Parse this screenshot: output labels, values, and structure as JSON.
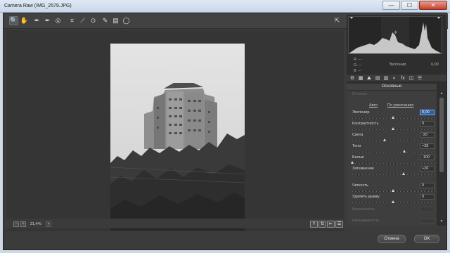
{
  "window": {
    "title": "Camera Raw (IMG_2579.JPG)",
    "minimize": "—",
    "maximize": "☐",
    "close": "✕"
  },
  "toolbar": {
    "tools": [
      {
        "icon": "zoom-icon",
        "glyph": "🔍"
      },
      {
        "icon": "hand-icon",
        "glyph": "✋"
      },
      {
        "icon": "white-balance-icon",
        "glyph": "✒"
      },
      {
        "icon": "color-sampler-icon",
        "glyph": "✒"
      },
      {
        "icon": "targeted-adjust-icon",
        "glyph": "◎"
      },
      {
        "icon": "crop-icon",
        "glyph": "⌗"
      },
      {
        "icon": "straighten-icon",
        "glyph": "⟋"
      },
      {
        "icon": "red-eye-icon",
        "glyph": "⊙"
      },
      {
        "icon": "brush-icon",
        "glyph": "✎"
      },
      {
        "icon": "graduated-filter-icon",
        "glyph": "▤"
      },
      {
        "icon": "radial-filter-icon",
        "glyph": "◯"
      }
    ],
    "fullscreen_glyph": "⇱"
  },
  "preview": {
    "zoom": "21,4%",
    "zoom_minus": "−",
    "zoom_plus": "+",
    "zoom_dd": "▾"
  },
  "view_buttons": [
    {
      "icon": "before-after-y-icon",
      "glyph": "Y"
    },
    {
      "icon": "swap-icon",
      "glyph": "⇅"
    },
    {
      "icon": "copy-settings-icon",
      "glyph": "⇤"
    },
    {
      "icon": "preferences-icon",
      "glyph": "☰"
    }
  ],
  "histogram": {
    "r_label": "R:",
    "g_label": "G:",
    "b_label": "B:",
    "r": "---",
    "g": "---",
    "b": "---",
    "readout_label": "Экспонир",
    "readout_value": "0,00"
  },
  "panel_tabs": [
    "⚙",
    "▦",
    "⛰",
    "▤",
    "▥",
    "◐",
    "fx",
    "◫",
    "☰"
  ],
  "panel": {
    "title": "Основные",
    "wb_faded": "Оттенок",
    "auto": "Авто",
    "default": "По умолчанию",
    "sliders": [
      {
        "label": "Экспонир",
        "value": "0,00",
        "pos": 0.5,
        "selected": true
      },
      {
        "label": "Контрастность",
        "value": "0",
        "pos": 0.5
      },
      {
        "label": "Света",
        "value": "-20",
        "pos": 0.4
      },
      {
        "label": "Тени",
        "value": "+28",
        "pos": 0.64
      },
      {
        "label": "Белые",
        "value": "-100",
        "pos": 0.0
      },
      {
        "label": "Затемнение",
        "value": "+26",
        "pos": 0.63
      },
      {
        "label": "Четкость",
        "value": "0",
        "pos": 0.5
      },
      {
        "label": "Удалить дымку",
        "value": "0",
        "pos": 0.5
      },
      {
        "label": "Красочность",
        "value": "",
        "pos": 0.5,
        "dim": true
      },
      {
        "label": "Насыщенность",
        "value": "",
        "pos": 0.5,
        "dim": true
      }
    ]
  },
  "footer": {
    "cancel": "Отмена",
    "ok": "OK"
  }
}
